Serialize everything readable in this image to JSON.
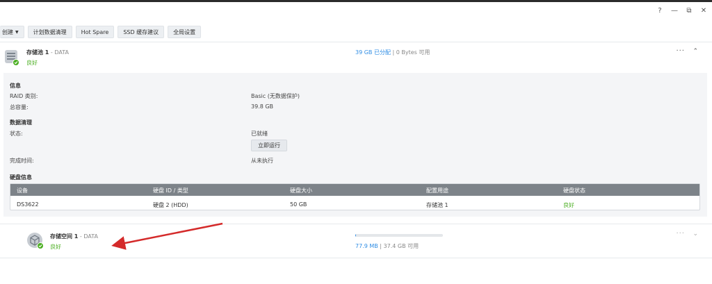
{
  "window": {
    "controls": {
      "help": "?",
      "minimize": "—",
      "restore": "⧉",
      "close": "✕"
    }
  },
  "toolbar": {
    "create_label": "创建",
    "scrub_label": "计划数据清理",
    "hotspare_label": "Hot Spare",
    "ssd_label": "SSD 缓存建议",
    "global_label": "全局设置"
  },
  "pool": {
    "name": "存储池 1",
    "sub": " - DATA",
    "status": "良好",
    "allocated": "39 GB 已分配",
    "separator": " | ",
    "available": "0 Bytes 可用",
    "more": "···",
    "collapse": "⌃"
  },
  "info": {
    "title": "信息",
    "raid_label": "RAID 类别:",
    "raid_value": "Basic (无数据保护)",
    "capacity_label": "总容量:",
    "capacity_value": "39.8 GB"
  },
  "scrub": {
    "title": "数据清理",
    "state_label": "状态:",
    "state_value": "已就绪",
    "run_button": "立即运行",
    "done_label": "完成时间:",
    "done_value": "从未执行"
  },
  "disks": {
    "title": "硬盘信息",
    "columns": [
      "设备",
      "硬盘 ID / 类型",
      "硬盘大小",
      "配置用途",
      "硬盘状态"
    ],
    "rows": [
      [
        "DS3622",
        "硬盘 2 (HDD)",
        "50 GB",
        "存储池 1",
        "良好"
      ]
    ]
  },
  "volume": {
    "name": "存储空间 1",
    "sub": " - DATA",
    "status": "良好",
    "used": "77.9 MB",
    "separator": " | ",
    "available": "37.4 GB 可用",
    "usage_fraction": 0.002,
    "more": "···",
    "expand": "⌄"
  },
  "colors": {
    "good": "#4caf23",
    "accent": "#2f8de4",
    "arrow": "#d42a2a"
  }
}
